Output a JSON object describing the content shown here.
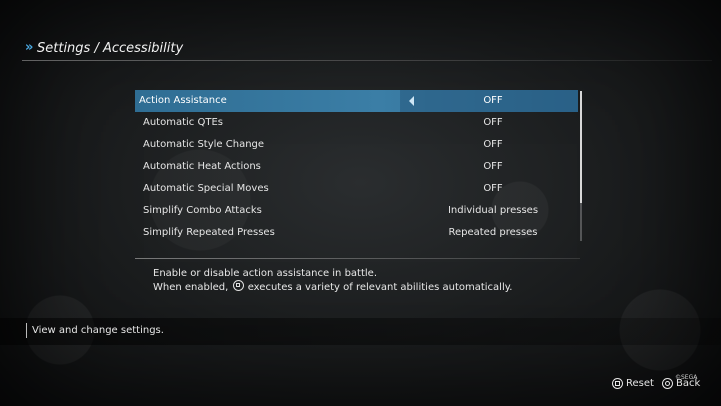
{
  "header": {
    "title": "Settings / Accessibility"
  },
  "options": [
    {
      "label": "Action Assistance",
      "value": "OFF",
      "selected": true
    },
    {
      "label": "Automatic QTEs",
      "value": "OFF"
    },
    {
      "label": "Automatic Style Change",
      "value": "OFF"
    },
    {
      "label": "Automatic Heat Actions",
      "value": "OFF"
    },
    {
      "label": "Automatic Special Moves",
      "value": "OFF"
    },
    {
      "label": "Simplify Combo Attacks",
      "value": "Individual presses"
    },
    {
      "label": "Simplify Repeated Presses",
      "value": "Repeated presses"
    }
  ],
  "description": {
    "line1": "Enable or disable action assistance in battle.",
    "line2_before": "When enabled,",
    "line2_after": "executes a variety of relevant abilities automatically."
  },
  "help": "View and change settings.",
  "footer": {
    "reset": "Reset",
    "back": "Back",
    "copyright": "©SEGA"
  },
  "colors": {
    "accent": "#4aa8e0",
    "selection": "#3b7ea6"
  },
  "icons": {
    "header_mark": "»"
  }
}
